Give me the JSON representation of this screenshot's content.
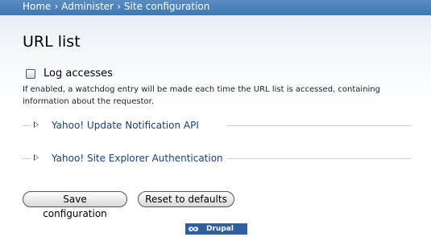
{
  "breadcrumb": {
    "items": [
      "Home",
      "Administer",
      "Site configuration"
    ],
    "separator": "›"
  },
  "page": {
    "title": "URL list"
  },
  "settings": {
    "log_accesses": {
      "label": "Log accesses",
      "checked": false,
      "description": "If enabled, a watchdog entry will be made each time the URL list is accessed, containing information about the requestor."
    }
  },
  "fieldsets": [
    {
      "legend": "Yahoo! Update Notification API",
      "collapsed": true
    },
    {
      "legend": "Yahoo! Site Explorer Authentication",
      "collapsed": true
    }
  ],
  "actions": {
    "save_label": "Save configuration",
    "reset_label": "Reset to defaults"
  },
  "footer": {
    "badge_text": "Drupal"
  },
  "colors": {
    "header_bar": "#4a82bb",
    "legend_link": "#1b3f77",
    "badge": "#2d5fa1"
  }
}
